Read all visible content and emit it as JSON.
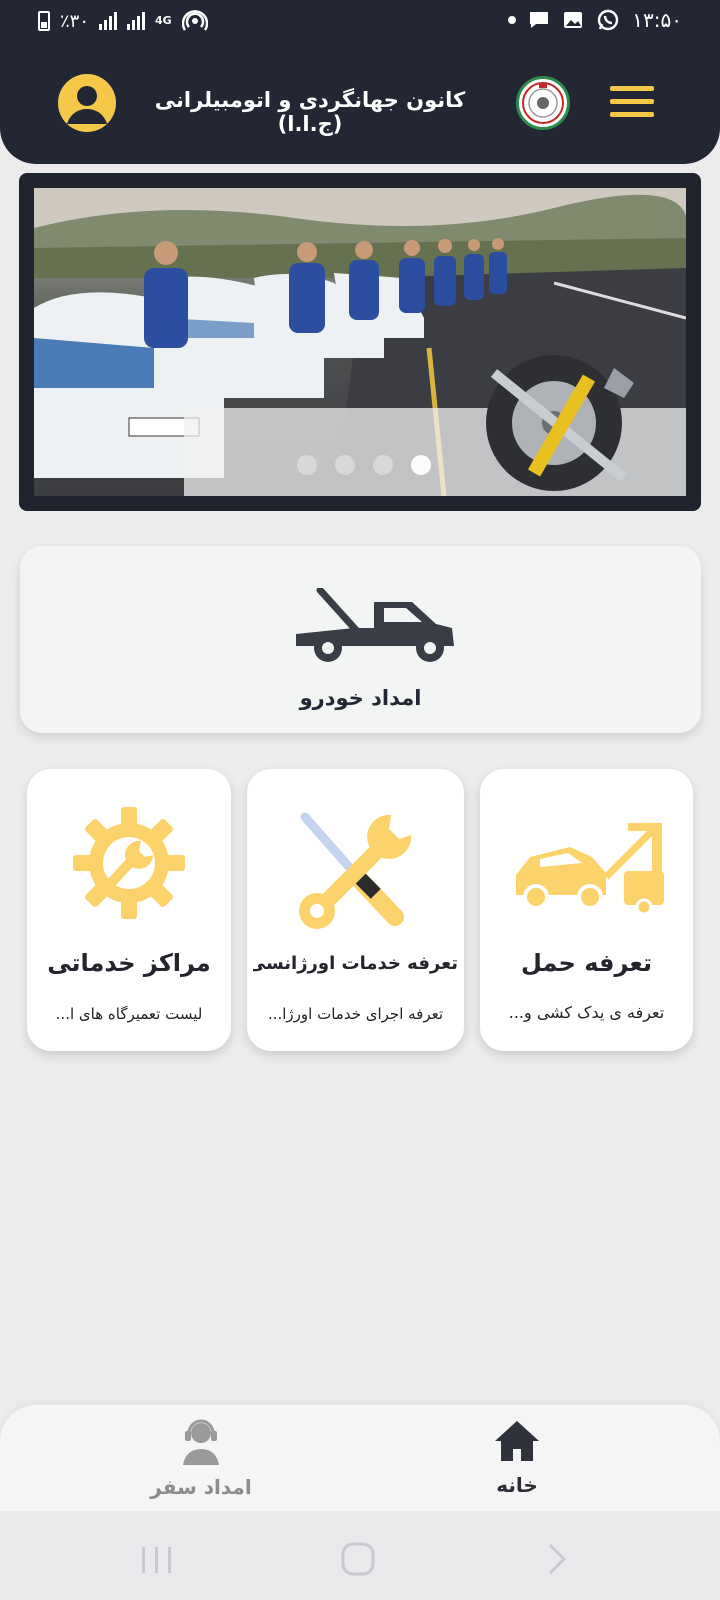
{
  "status_bar": {
    "battery_percent": "٪۳۰",
    "network": "4G",
    "time": "۱۳:۵۰"
  },
  "header": {
    "title": "کانون جهانگردی و اتومبیلرانی (ج.ا.ا)",
    "profile_icon": "user-circle-icon",
    "logo_icon": "emblem-logo",
    "menu_icon": "hamburger-menu-icon",
    "accent": "#f6c84a",
    "background": "#222733"
  },
  "banner": {
    "slide_count": 4,
    "active_slide": 4
  },
  "main_service": {
    "label": "امداد خودرو",
    "icon": "tow-truck-icon"
  },
  "services": [
    {
      "title": "تعرفه حمل",
      "subtitle": "تعرفه ی یدک کشی و...",
      "icon": "tow-car-icon"
    },
    {
      "title": "تعرفه خدمات اورژانسی",
      "subtitle": "تعرفه اجرای خدمات اورژا...",
      "icon": "wrench-screwdriver-icon"
    },
    {
      "title": "مراکز خدماتی",
      "subtitle": "لیست تعمیرگاه های ا...",
      "icon": "gear-wrench-icon"
    }
  ],
  "bottom_nav": {
    "items": [
      {
        "label": "خانه",
        "icon": "home-icon",
        "active": true
      },
      {
        "label": "امداد سفر",
        "icon": "support-agent-icon",
        "active": false
      }
    ]
  }
}
